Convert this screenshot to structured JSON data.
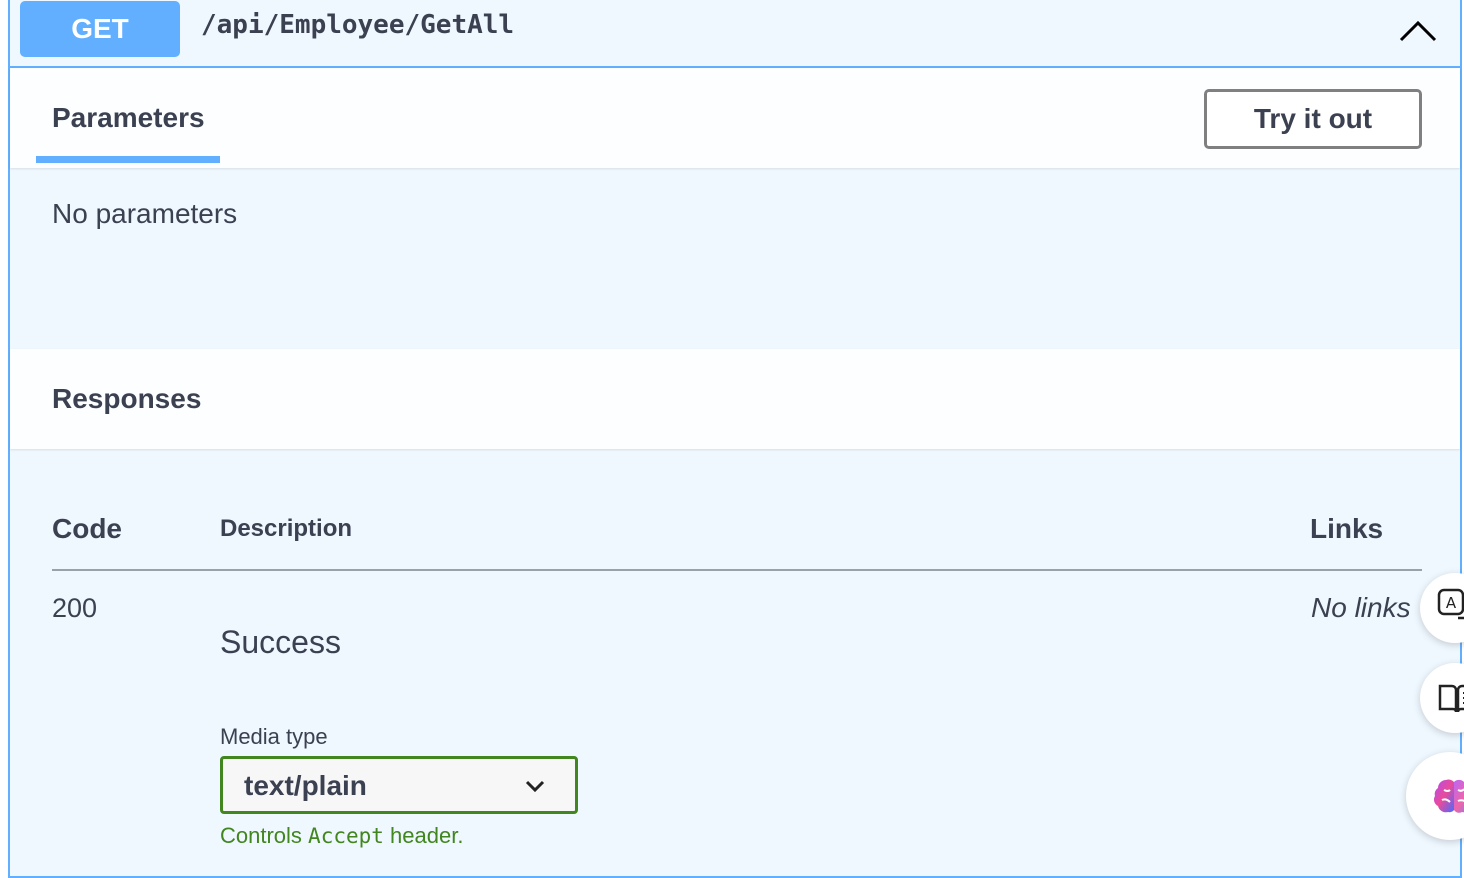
{
  "operation": {
    "method": "GET",
    "path": "/api/Employee/GetAll"
  },
  "parameters": {
    "tab_label": "Parameters",
    "try_button": "Try it out",
    "empty_text": "No parameters"
  },
  "responses": {
    "title": "Responses",
    "columns": {
      "code": "Code",
      "description": "Description",
      "links": "Links"
    },
    "rows": [
      {
        "code": "200",
        "description": "Success",
        "links": "No links",
        "media_type_label": "Media type",
        "media_type_value": "text/plain",
        "controls_prefix": "Controls",
        "controls_code": "Accept",
        "controls_suffix": "header."
      }
    ]
  },
  "colors": {
    "get_accent": "#61affe",
    "select_border": "#41861e",
    "text": "#3b4151"
  },
  "floating_buttons": [
    "translate-icon",
    "reader-icon",
    "brain-assistant-icon"
  ]
}
